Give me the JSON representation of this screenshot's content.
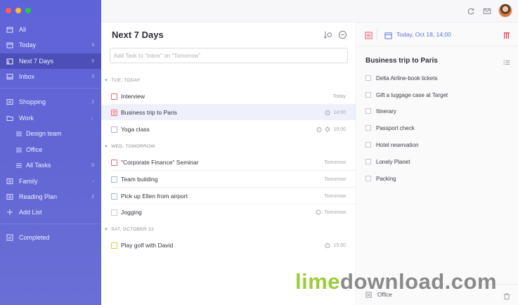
{
  "window": {
    "traffic_lights": [
      "close",
      "minimize",
      "zoom"
    ]
  },
  "toolbar": {
    "sync_icon": "sync-icon",
    "inbox_icon": "mail-icon",
    "avatar": "user-avatar"
  },
  "sidebar": {
    "items": [
      {
        "label": "All",
        "count": "",
        "icon": "calendar-icon"
      },
      {
        "label": "Today",
        "count": "3",
        "icon": "calendar-icon"
      },
      {
        "label": "Next 7 Days",
        "count": "9",
        "icon": "calendar-week-icon",
        "active": true
      },
      {
        "label": "Inbox",
        "count": "3",
        "icon": "inbox-icon"
      },
      {
        "label": "Shopping",
        "count": "2",
        "icon": "list-icon"
      },
      {
        "label": "Work",
        "count": "",
        "icon": "folder-icon"
      },
      {
        "label": "Design team",
        "count": "",
        "icon": "list-icon"
      },
      {
        "label": "Office",
        "count": "",
        "icon": "list-icon"
      },
      {
        "label": "All Tasks",
        "count": "5",
        "icon": "list-icon"
      },
      {
        "label": "Family",
        "count": "",
        "icon": "list-icon"
      },
      {
        "label": "Reading Plan",
        "count": "2",
        "icon": "list-icon"
      },
      {
        "label": "Add List",
        "count": "",
        "icon": "plus-icon"
      },
      {
        "label": "Completed",
        "count": "",
        "icon": "check-square-icon"
      }
    ]
  },
  "main": {
    "title": "Next 7 Days",
    "add_placeholder": "Add Task to \"Inbox\" on \"Tomorrow\"",
    "sections": [
      {
        "header": "TUE, TODAY",
        "tasks": [
          {
            "title": "Interview",
            "due": "Today",
            "priority": "red"
          },
          {
            "title": "Business trip to Paris",
            "due": "14:00",
            "priority": "note",
            "selected": true
          },
          {
            "title": "Yoga class",
            "due": "19:00",
            "priority": "blue"
          }
        ]
      },
      {
        "header": "WED, TOMORROW",
        "tasks": [
          {
            "title": "\"Corporate Finance\" Seminar",
            "due": "Tomorrow",
            "priority": "red"
          },
          {
            "title": "Team building",
            "due": "Tomorrow",
            "priority": "blue"
          },
          {
            "title": "Pick up Ellen from airport",
            "due": "Tomorrow",
            "priority": "blue"
          },
          {
            "title": "Jogging",
            "due": "Tomorrow",
            "priority": "gray"
          }
        ]
      },
      {
        "header": "SAT, OCTOBER 22",
        "tasks": [
          {
            "title": "Play golf with David",
            "due": "15:00",
            "priority": "yellow"
          }
        ]
      }
    ]
  },
  "detail": {
    "date": "Today, Oct 18, 14:00",
    "title": "Business trip to Paris",
    "checklist": [
      "Delta Airline-book tickets",
      "Gift a luggage case at Target",
      "Itinerary",
      "Passport check",
      "Hotel reservation",
      "Lonely Planet",
      "Packing"
    ],
    "list_name": "Office"
  },
  "watermark": {
    "part1": "lime",
    "part2": "download.com"
  },
  "colors": {
    "accent": "#5b73d8",
    "sidebar": "#6266d4",
    "red": "#e56b7a",
    "yellow": "#e8c246"
  }
}
